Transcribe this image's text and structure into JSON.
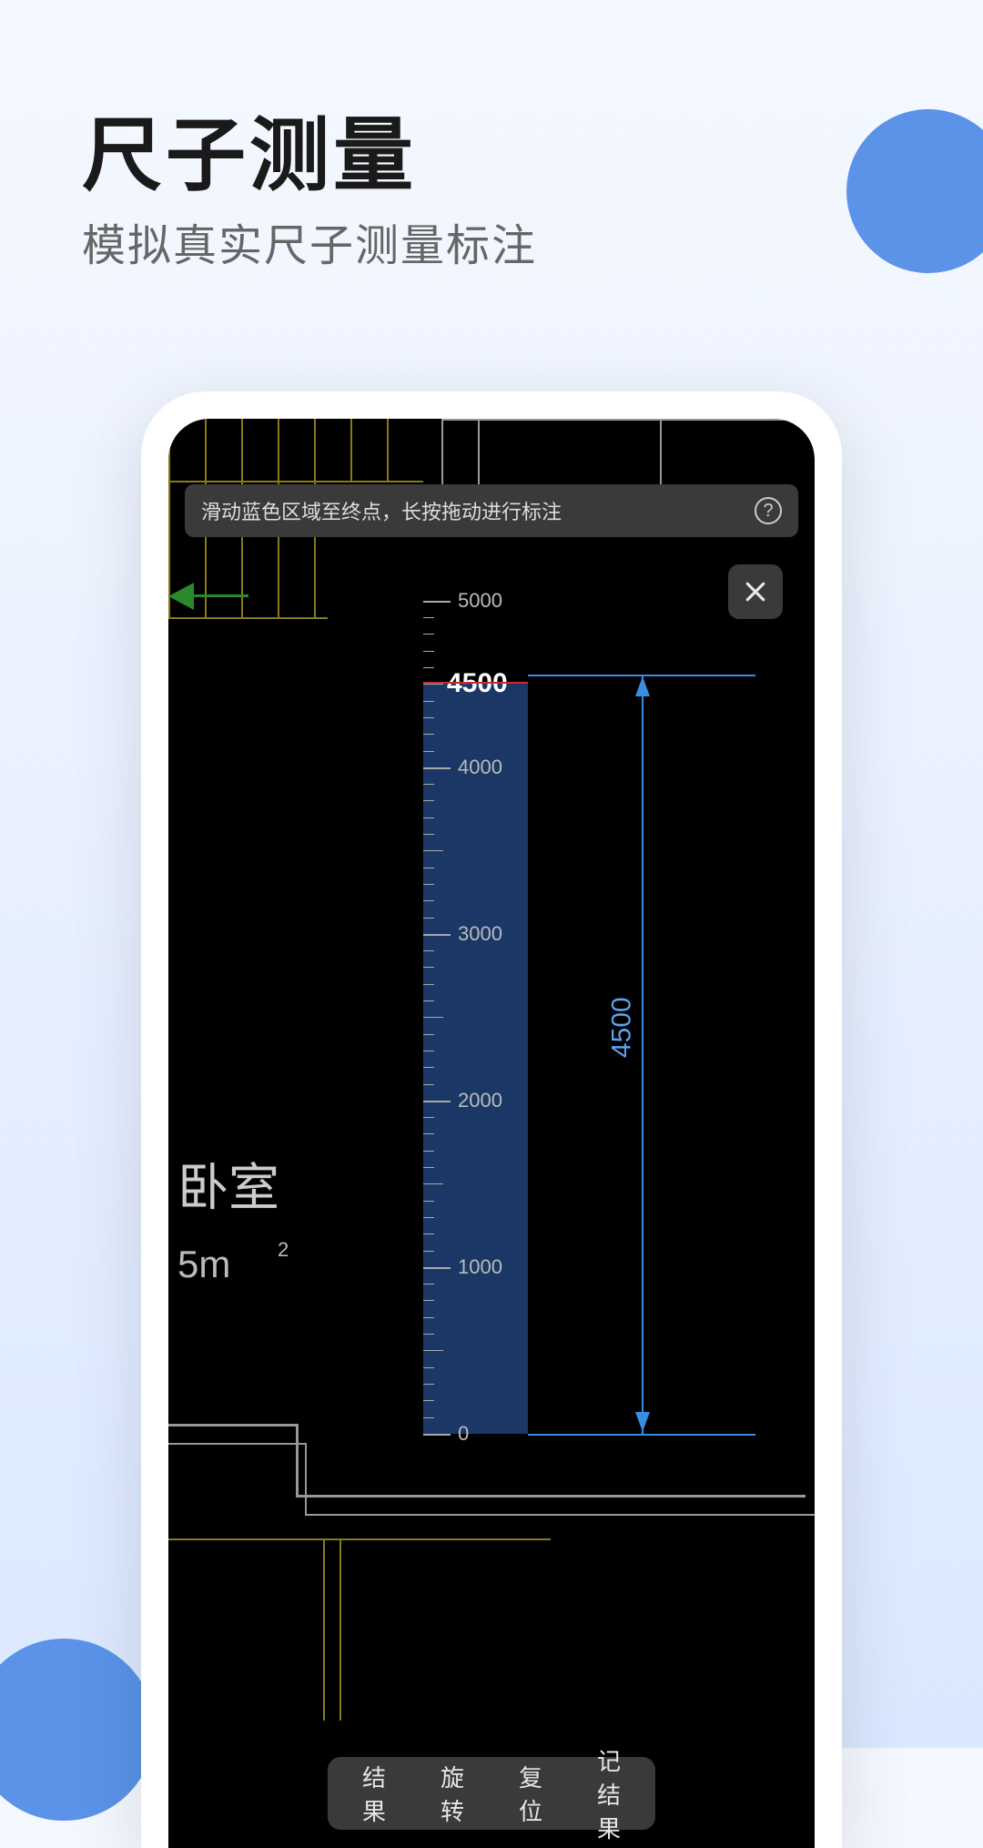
{
  "headline": "尺子测量",
  "subhead": "模拟真实尺子测量标注",
  "instruction": "滑动蓝色区域至终点，长按拖动进行标注",
  "ruler": {
    "ticks": [
      {
        "v": 5000,
        "label": "5000"
      },
      {
        "v": 4000,
        "label": "4000"
      },
      {
        "v": 3000,
        "label": "3000"
      },
      {
        "v": 2000,
        "label": "2000"
      },
      {
        "v": 1000,
        "label": "1000"
      },
      {
        "v": 0,
        "label": "0"
      }
    ],
    "cursor_value": "4500"
  },
  "dimension": {
    "value": "4500"
  },
  "room": {
    "name_partial": "卧室",
    "area_partial": "5m",
    "area_exp": "2"
  },
  "toolbar": {
    "result": "结果",
    "rotate": "旋转",
    "reset": "复位",
    "record": "记结果"
  }
}
